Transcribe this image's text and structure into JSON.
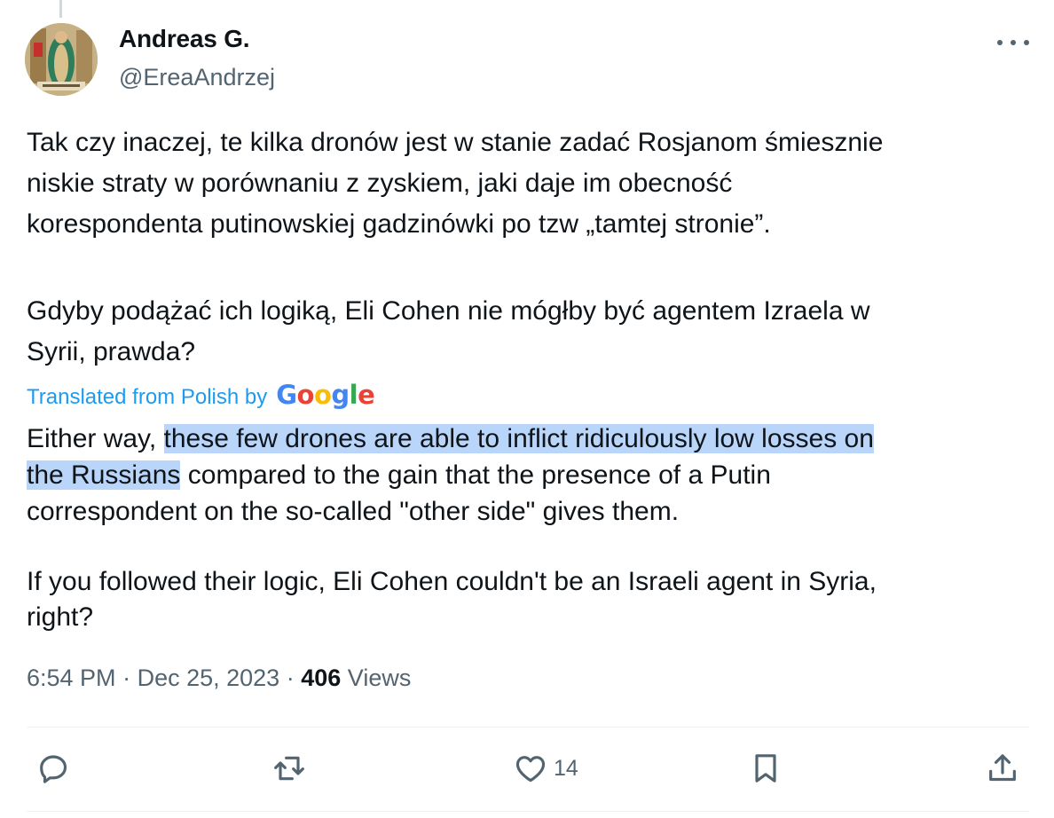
{
  "tweet": {
    "author_name": "Andreas G.",
    "author_handle": "@EreaAndrzej",
    "original_text_p1": "Tak czy inaczej, te kilka dronów jest w stanie zadać Rosjanom śmiesznie\nniskie straty w porównaniu z zyskiem, jaki daje im obecność\nkorespondenta putinowskiej gadzinówki po tzw „tamtej stronie”.",
    "original_text_p2": "Gdyby podążać ich logiką, Eli Cohen nie mógłby być agentem Izraela w\nSyrii, prawda?",
    "translated_label": "Translated from Polish by",
    "translation_p1_pre": "Either way, ",
    "translation_p1_highlight_a": "these few drones are able to inflict ridiculously low losses on",
    "translation_p1_highlight_b": "the Russians",
    "translation_p1_post_a": " compared to the gain that the presence of a Putin",
    "translation_p1_post_b": "correspondent on the so-called \"other side\" gives them.",
    "translation_p2": "If you followed their logic, Eli Cohen couldn't be an Israeli agent in Syria,\nright?",
    "time": "6:54 PM",
    "date": "Dec 25, 2023",
    "views_count": "406",
    "views_label": "Views",
    "likes_count": "14"
  },
  "colors": {
    "accent": "#1d9bf0",
    "highlight": "#b9d6fa",
    "secondary_text": "#536471"
  },
  "icons": [
    "more-icon",
    "reply-icon",
    "retweet-icon",
    "like-icon",
    "bookmark-icon",
    "share-icon"
  ]
}
